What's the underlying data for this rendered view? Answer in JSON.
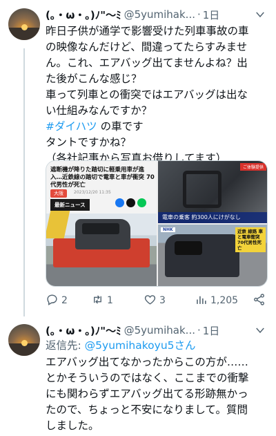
{
  "tweets": [
    {
      "display_name": "(｡・ω・｡)ﾉ\"〜ﾐ",
      "handle": "@5yumihak...",
      "separator": "·",
      "time": "1日",
      "lines": [
        "昨日子供が通学で影響受けた列車事故の車",
        "の映像なんだけど、間違ってたらすみませ",
        "ん。これ、エアバッグ出てませんよね？出",
        "た後がこんな感じ？",
        "車って列車との衝突ではエアバッグは出な",
        "い仕組みなんですか？"
      ],
      "hashtag": "#ダイハツ",
      "hashtag_suffix": " の車です",
      "lines_after": [
        "タントですかね？",
        "（各社記事から写真お借りしてます）"
      ],
      "media": {
        "left_headline": "遮断機が降りた踏切に軽乗用車が進入…近鉄線の踏切で電車と車が衝突 70代男性が死亡",
        "left_chip": "大阪",
        "left_timestamp": "2023/12/20 11:35",
        "left_news_label": "最新ニュース",
        "right_top_tag": "ご体験提供",
        "right_top_caption": "電車の乗客 約300人にけがなし",
        "right_bottom_logo": "NHK",
        "right_bottom_caption": "近鉄 線路 車と電車衝突 70代男性死亡"
      },
      "actions": {
        "reply_count": "2",
        "retweet_count": "1",
        "like_count": "3",
        "view_count": "1,205"
      }
    },
    {
      "display_name": "(｡・ω・｡)ﾉ\"〜ﾐ",
      "handle": "@5yumihak...",
      "separator": "·",
      "time": "1日",
      "reply_prefix": "返信先: ",
      "reply_mention": "@5yumihakoyu5さん",
      "lines": [
        "エアバッグ出てなかったからこの方が……",
        "とかそういうのではなく、ここまでの衝撃",
        "にも関わらずエアバッグ出てる形跡無かっ",
        "たので、ちょっと不安になりまして。質問",
        "しました。"
      ]
    }
  ],
  "colors": {
    "accent": "#1d9bf0",
    "text": "#0f1419",
    "secondary": "#536471",
    "border": "#cfd9de"
  },
  "icons": [
    "more-icon",
    "reply-icon",
    "retweet-icon",
    "like-icon",
    "views-icon",
    "share-icon"
  ]
}
